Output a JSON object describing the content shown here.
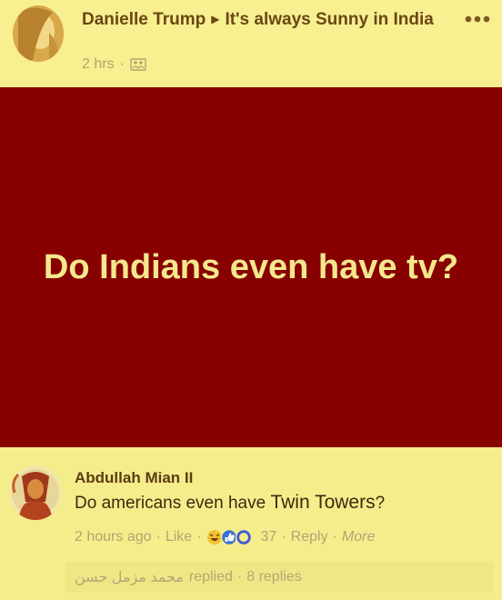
{
  "post": {
    "author": "Danielle Trump",
    "group": "It's always Sunny in India",
    "time": "2 hrs",
    "meta_separator": "·",
    "banner_text": "Do Indians even have tv?",
    "banner_color": "#880101",
    "banner_text_color": "#f3e88c"
  },
  "comment": {
    "author": "Abdullah Mian II",
    "text_before": "Do americans even have ",
    "text_highlight": "Twin Towers",
    "text_after": "?",
    "time": "2 hours ago",
    "like": "Like",
    "reaction_count": "37",
    "reply": "Reply",
    "more": "More",
    "separator": "·"
  },
  "replies": {
    "replier": "محمد مزمل حسن",
    "replied": "replied",
    "separator": "·",
    "count": "8 replies"
  },
  "icons": {
    "more": "ellipsis-icon",
    "audience": "friends-audience-icon",
    "group_arrow": "right-triangle-icon",
    "reactions": [
      "haha-reaction-icon",
      "like-reaction-icon",
      "love-reaction-icon"
    ]
  },
  "colors": {
    "background": "#f5ed8c",
    "author_text": "#6a4614",
    "muted_text": "#b6a271"
  }
}
